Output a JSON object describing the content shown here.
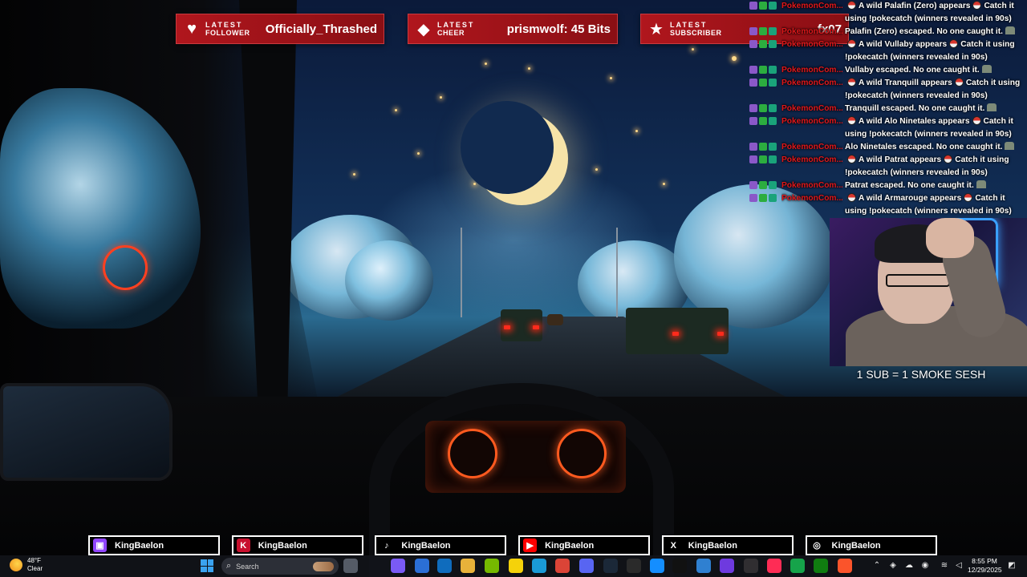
{
  "alerts": [
    {
      "kind_top": "LATEST",
      "kind_bottom": "FOLLOWER",
      "value": "Officially_Thrashed",
      "icon": "heart-icon"
    },
    {
      "kind_top": "LATEST",
      "kind_bottom": "CHEER",
      "value": "prismwolf: 45 Bits",
      "icon": "bits-diamond-icon"
    },
    {
      "kind_top": "LATEST",
      "kind_bottom": "SUBSCRIBER",
      "value": "fx07",
      "icon": "star-icon"
    }
  ],
  "chat": [
    {
      "user": "PokemonCom...",
      "text": "A wild Palafin (Zero) appears",
      "suffix": "Catch it using !pokecatch (winners revealed in 90s)",
      "type": "appear"
    },
    {
      "user": "PokemonCom...",
      "text": "Palafin (Zero) escaped. No one caught it.",
      "suffix": "",
      "type": "escape"
    },
    {
      "user": "PokemonCom...",
      "text": "A wild Vullaby appears",
      "suffix": "Catch it using !pokecatch (winners revealed in 90s)",
      "type": "appear"
    },
    {
      "user": "PokemonCom...",
      "text": "Vullaby escaped. No one caught it.",
      "suffix": "",
      "type": "escape"
    },
    {
      "user": "PokemonCom...",
      "text": "A wild Tranquill appears",
      "suffix": "Catch it using !pokecatch (winners revealed in 90s)",
      "type": "appear"
    },
    {
      "user": "PokemonCom...",
      "text": "Tranquill escaped. No one caught it.",
      "suffix": "",
      "type": "escape"
    },
    {
      "user": "PokemonCom...",
      "text": "A wild Alo Ninetales appears",
      "suffix": "Catch it using !pokecatch (winners revealed in 90s)",
      "type": "appear"
    },
    {
      "user": "PokemonCom...",
      "text": "Alo Ninetales escaped. No one caught it.",
      "suffix": "",
      "type": "escape"
    },
    {
      "user": "PokemonCom...",
      "text": "A wild Patrat appears",
      "suffix": "Catch it using !pokecatch (winners revealed in 90s)",
      "type": "appear"
    },
    {
      "user": "PokemonCom...",
      "text": "Patrat escaped. No one caught it.",
      "suffix": "",
      "type": "escape"
    },
    {
      "user": "PokemonCom...",
      "text": "A wild Armarouge appears",
      "suffix": "Catch it using !pokecatch (winners revealed in 90s)",
      "type": "appear"
    }
  ],
  "webcam": {
    "caption": "1 SUB = 1 SMOKE SESH"
  },
  "socials": [
    {
      "platform": "twitch",
      "handle": "KingBaelon",
      "icon": "twitch-icon",
      "color": "#9146ff"
    },
    {
      "platform": "kick",
      "handle": "KingBaelon",
      "icon": "kick-icon",
      "color": "#c8102e"
    },
    {
      "platform": "tiktok",
      "handle": "KingBaelon",
      "icon": "tiktok-icon",
      "color": "#000000"
    },
    {
      "platform": "youtube",
      "handle": "KingBaelon",
      "icon": "youtube-icon",
      "color": "#ff0000"
    },
    {
      "platform": "x",
      "handle": "KingBaelon",
      "icon": "x-icon",
      "color": "#000000"
    },
    {
      "platform": "instagram",
      "handle": "KingBaelon",
      "icon": "instagram-icon",
      "color": "#000000"
    }
  ],
  "taskbar": {
    "weather": {
      "temp": "48°F",
      "condition": "Clear"
    },
    "search_placeholder": "Search",
    "apps": [
      {
        "name": "task-view",
        "color": "#555b66"
      },
      {
        "name": "copilot",
        "color": "#7a5af5"
      },
      {
        "name": "microsoft-store",
        "color": "#2b6fd6"
      },
      {
        "name": "outlook",
        "color": "#0f6cbd"
      },
      {
        "name": "file-explorer",
        "color": "#e8b23a"
      },
      {
        "name": "nvidia",
        "color": "#76b900"
      },
      {
        "name": "sticky-notes",
        "color": "#f5d20a"
      },
      {
        "name": "edge",
        "color": "#1a9ad6"
      },
      {
        "name": "chrome",
        "color": "#db4437"
      },
      {
        "name": "discord",
        "color": "#5865f2"
      },
      {
        "name": "steam",
        "color": "#1b2838"
      },
      {
        "name": "epic-games",
        "color": "#2a2a2a"
      },
      {
        "name": "battle-net",
        "color": "#148eff"
      },
      {
        "name": "capcut",
        "color": "#111111"
      },
      {
        "name": "vscode",
        "color": "#2f80d1"
      },
      {
        "name": "streaming-app",
        "color": "#6e3adf"
      },
      {
        "name": "obs",
        "color": "#302e31"
      },
      {
        "name": "tiktok-live",
        "color": "#fe2c55"
      },
      {
        "name": "pokemon-app",
        "color": "#16a34a"
      },
      {
        "name": "xbox",
        "color": "#107c10"
      },
      {
        "name": "brave",
        "color": "#fb542b"
      }
    ],
    "clock": {
      "time": "8:55 PM",
      "date": "12/29/2025"
    }
  }
}
